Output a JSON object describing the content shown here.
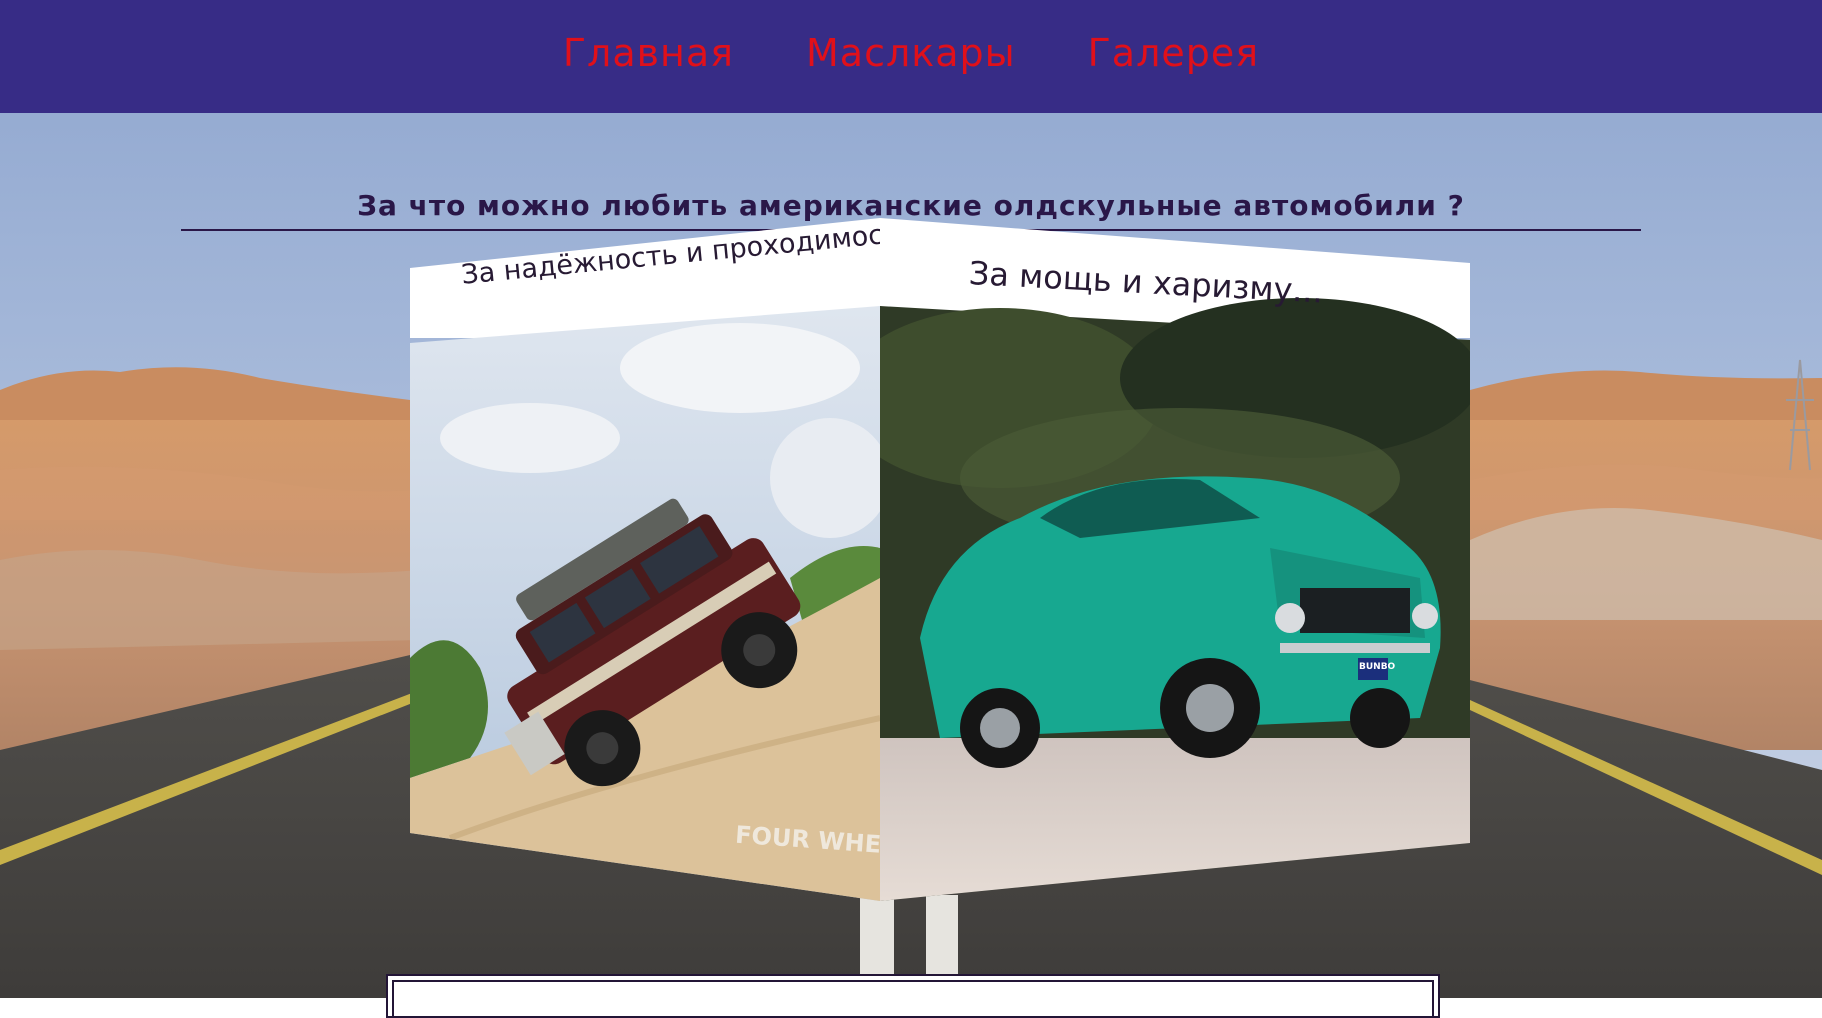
{
  "nav": {
    "items": [
      {
        "label": "Главная"
      },
      {
        "label": "Маслкары"
      },
      {
        "label": "Галерея"
      }
    ]
  },
  "main": {
    "title": "За что можно любить американские олдскульные автомобили ?"
  },
  "cube": {
    "left_face": {
      "caption": "За надёжность и проходимость...",
      "watermark": "FOUR WHEELER"
    },
    "right_face": {
      "caption": "За мощь и харизму...",
      "plate": "BUNBO"
    }
  },
  "colors": {
    "nav_bg": "#372c86",
    "nav_link": "#e0101a",
    "heading": "#2a1748"
  },
  "icons": {
    "left_image": "offroad-wagon-image",
    "right_image": "muscle-car-image"
  }
}
